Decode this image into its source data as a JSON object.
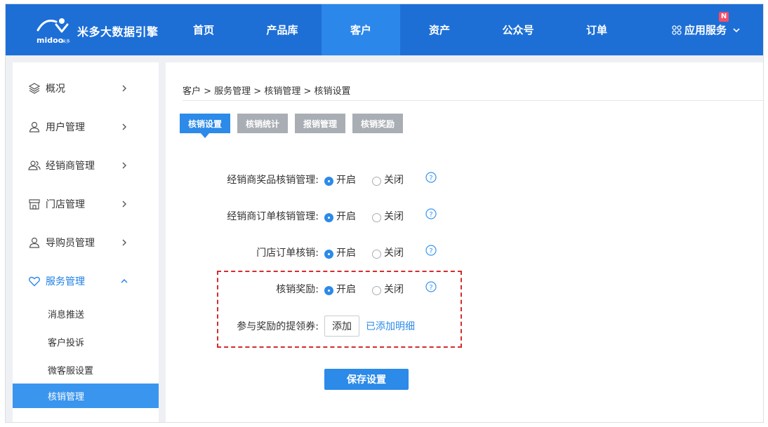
{
  "brand": {
    "logo_text": "midoo",
    "logo_sub": "米多",
    "name": "米多大数据引擎"
  },
  "nav": {
    "items": [
      {
        "label": "首页"
      },
      {
        "label": "产品库"
      },
      {
        "label": "客户"
      },
      {
        "label": "资产"
      },
      {
        "label": "公众号"
      },
      {
        "label": "订单"
      }
    ],
    "active": "客户",
    "apps_label": "应用服务",
    "new_badge": "N"
  },
  "sidebar": {
    "items": [
      {
        "label": "概况",
        "icon": "layers-icon"
      },
      {
        "label": "用户管理",
        "icon": "user-icon"
      },
      {
        "label": "经销商管理",
        "icon": "users-icon"
      },
      {
        "label": "门店管理",
        "icon": "store-icon"
      },
      {
        "label": "导购员管理",
        "icon": "user-icon"
      },
      {
        "label": "服务管理",
        "icon": "heart-icon"
      }
    ],
    "sub_items": [
      {
        "label": "消息推送"
      },
      {
        "label": "客户投诉"
      },
      {
        "label": "微客服设置"
      },
      {
        "label": "核销管理"
      }
    ],
    "active_sub": "核销管理"
  },
  "main": {
    "breadcrumb": "客户 > 服务管理 > 核销管理 > 核销设置",
    "tabs": [
      {
        "label": "核销设置"
      },
      {
        "label": "核销统计"
      },
      {
        "label": "报销管理"
      },
      {
        "label": "核销奖励"
      }
    ],
    "active_tab": "核销设置",
    "settings": [
      {
        "label": "经销商奖品核销管理:",
        "on": "开启",
        "off": "关闭",
        "value": "开启"
      },
      {
        "label": "经销商订单核销管理:",
        "on": "开启",
        "off": "关闭",
        "value": "开启"
      },
      {
        "label": "门店订单核销:",
        "on": "开启",
        "off": "关闭",
        "value": "开启"
      },
      {
        "label": "核销奖励:",
        "on": "开启",
        "off": "关闭",
        "value": "开启"
      }
    ],
    "coupon_label": "参与奖励的提领券:",
    "add_button": "添加",
    "added_link": "已添加明细",
    "save_button": "保存设置"
  },
  "colors": {
    "topbar": "#1d6fd6",
    "accent": "#2c8ae8",
    "highlight_box": "#d42c2c"
  }
}
